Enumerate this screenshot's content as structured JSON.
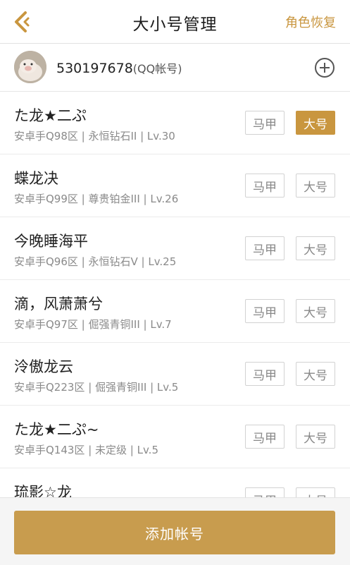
{
  "header": {
    "title": "大小号管理",
    "restore_label": "角色恢复",
    "accent_color": "#c9963f"
  },
  "qq": {
    "number": "530197678",
    "suffix": "(QQ帐号)"
  },
  "accounts": [
    {
      "name": "た龙★二ぷ",
      "info": "安卓手Q98区 | 永恒钻石II | Lv.30",
      "alt_label": "马甲",
      "main_label": "大号",
      "is_main": true
    },
    {
      "name": "蝶龙决",
      "info": "安卓手Q99区 | 尊贵铂金III | Lv.26",
      "alt_label": "马甲",
      "main_label": "大号",
      "is_main": false
    },
    {
      "name": "今晚睡海平",
      "info": "安卓手Q96区 | 永恒钻石V | Lv.25",
      "alt_label": "马甲",
      "main_label": "大号",
      "is_main": false
    },
    {
      "name": "滴，风萧萧兮",
      "info": "安卓手Q97区 | 倔强青铜III | Lv.7",
      "alt_label": "马甲",
      "main_label": "大号",
      "is_main": false
    },
    {
      "name": "泠傲龙云",
      "info": "安卓手Q223区 | 倔强青铜III | Lv.5",
      "alt_label": "马甲",
      "main_label": "大号",
      "is_main": false
    },
    {
      "name": "た龙★二ぷ~",
      "info": "安卓手Q143区 | 未定级 | Lv.5",
      "alt_label": "马甲",
      "main_label": "大号",
      "is_main": false
    },
    {
      "name": "琉影☆龙",
      "info": "",
      "alt_label": "马甲",
      "main_label": "大号",
      "is_main": false
    }
  ],
  "footer": {
    "add_label": "添加帐号"
  }
}
